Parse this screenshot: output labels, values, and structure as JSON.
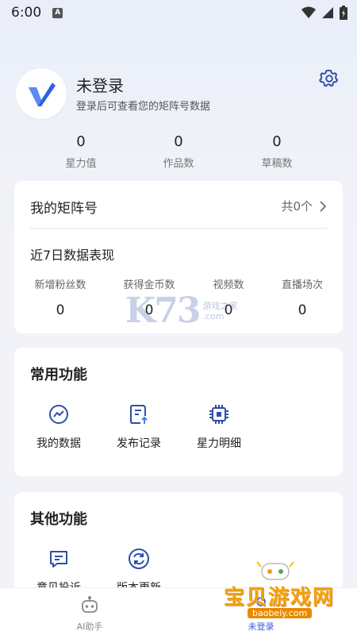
{
  "status_bar": {
    "time": "6:00",
    "app_indicator": "A"
  },
  "profile": {
    "username": "未登录",
    "subtitle": "登录后可查看您的矩阵号数据"
  },
  "stats": [
    {
      "value": "0",
      "label": "星力值"
    },
    {
      "value": "0",
      "label": "作品数"
    },
    {
      "value": "0",
      "label": "草稿数"
    }
  ],
  "matrix": {
    "title": "我的矩阵号",
    "count_label": "共0个",
    "week_title": "近7日数据表现",
    "metrics": [
      {
        "label": "新增粉丝数",
        "value": "0"
      },
      {
        "label": "获得金币数",
        "value": "0"
      },
      {
        "label": "视频数",
        "value": "0"
      },
      {
        "label": "直播场次",
        "value": "0"
      }
    ]
  },
  "common_functions": {
    "title": "常用功能",
    "items": [
      {
        "label": "我的数据",
        "icon": "trend-chart-icon"
      },
      {
        "label": "发布记录",
        "icon": "publish-record-icon"
      },
      {
        "label": "星力明细",
        "icon": "chip-icon"
      }
    ]
  },
  "other_functions": {
    "title": "其他功能",
    "items": [
      {
        "label": "意见投诉",
        "icon": "feedback-icon"
      },
      {
        "label": "版本更新",
        "icon": "refresh-icon"
      }
    ]
  },
  "bottom_nav": {
    "items": [
      {
        "label": "AI助手",
        "icon": "robot-icon"
      },
      {
        "label": "未登录",
        "icon": "user-icon"
      }
    ]
  },
  "watermarks": {
    "site_logo": "K73",
    "site_tagline": "游戏之家",
    "site_url": ".com",
    "badge_text": "宝贝游戏网",
    "badge_url": "baobeiy.com"
  },
  "colors": {
    "accent": "#3b5bdb",
    "icon_blue": "#2e4fa8",
    "logo_blue": "#2e62e0"
  }
}
